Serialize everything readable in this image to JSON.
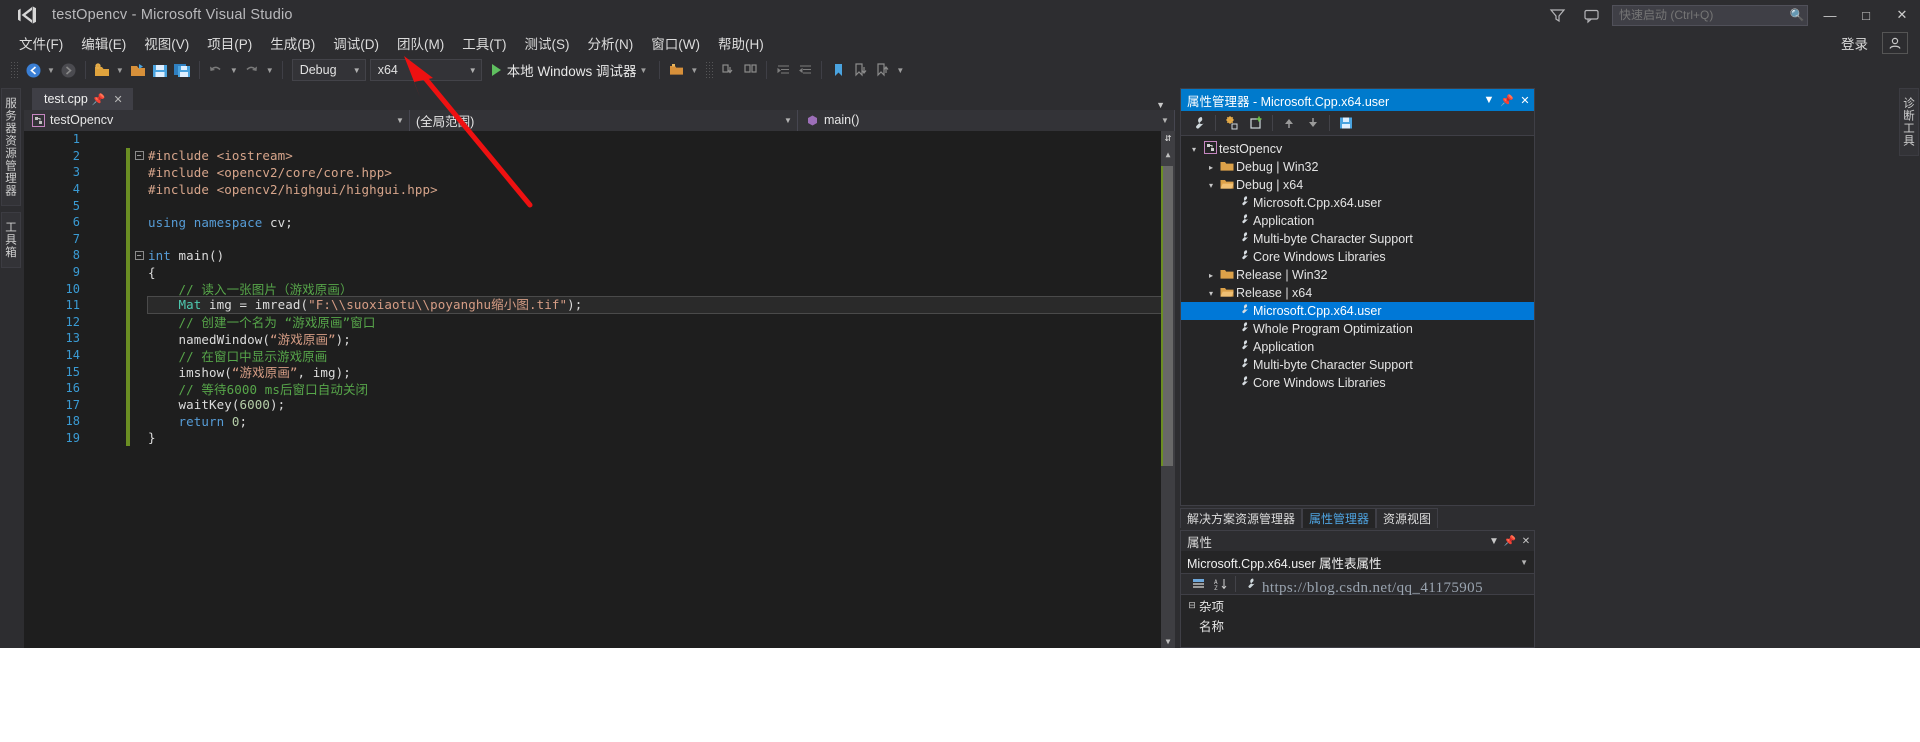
{
  "app": {
    "title": "testOpencv - Microsoft Visual Studio",
    "logo_icon": "visual-studio-logo"
  },
  "titlebar": {
    "filter_icon": "funnel-icon",
    "feedback_icon": "feedback-icon",
    "quick_launch_placeholder": "快速启动 (Ctrl+Q)",
    "quick_launch_value": "",
    "search_icon": "search-icon",
    "minimize": "—",
    "maximize": "□",
    "close": "✕"
  },
  "menubar": {
    "items": [
      {
        "label": "文件(F)"
      },
      {
        "label": "编辑(E)"
      },
      {
        "label": "视图(V)"
      },
      {
        "label": "项目(P)"
      },
      {
        "label": "生成(B)"
      },
      {
        "label": "调试(D)"
      },
      {
        "label": "团队(M)"
      },
      {
        "label": "工具(T)"
      },
      {
        "label": "测试(S)"
      },
      {
        "label": "分析(N)"
      },
      {
        "label": "窗口(W)"
      },
      {
        "label": "帮助(H)"
      }
    ],
    "login_label": "登录",
    "account_icon": "account-icon"
  },
  "toolbar": {
    "nav_back_icon": "navigate-back-icon",
    "nav_forward_icon": "navigate-forward-icon",
    "new_project_icon": "new-project-icon",
    "open_file_icon": "open-file-icon",
    "save_icon": "save-icon",
    "save_all_icon": "save-all-icon",
    "undo_icon": "undo-icon",
    "redo_icon": "redo-icon",
    "config_value": "Debug",
    "platform_value": "x64",
    "run_icon": "start-debug-icon",
    "run_label": "本地 Windows 调试器",
    "extra_icons": [
      "folder-icon",
      "step-into-icon",
      "step-over-icon",
      "indent-icon",
      "outdent-icon",
      "bookmark-icon",
      "bookmark-next-icon",
      "bookmark-prev-icon"
    ]
  },
  "left_rail": {
    "tabs": [
      {
        "label": "服务器资源管理器"
      },
      {
        "label": "工具箱"
      }
    ]
  },
  "right_rail": {
    "tabs": [
      {
        "label": "诊断工具"
      }
    ]
  },
  "editor": {
    "tab": {
      "filename": "test.cpp",
      "pin_icon": "pin-icon",
      "close_icon": "close-icon"
    },
    "tabstrip_overflow_icon": "chevron-down-icon",
    "navbar": {
      "project": "testOpencv",
      "project_icon": "cpp-project-icon",
      "scope": "(全局范围)",
      "function": "main()",
      "function_icon": "method-icon",
      "dropdown_icon": "chevron-down-icon"
    },
    "lines": [
      {
        "n": "1",
        "change": "none",
        "fold": "none",
        "tokens": []
      },
      {
        "n": "2",
        "change": "green",
        "fold": "minus",
        "tokens": [
          {
            "t": "pre",
            "v": "#include <iostream>"
          }
        ]
      },
      {
        "n": "3",
        "change": "green",
        "fold": "bar",
        "tokens": [
          {
            "t": "pre",
            "v": "#include <opencv2/core/core.hpp>"
          }
        ]
      },
      {
        "n": "4",
        "change": "green",
        "fold": "barend",
        "tokens": [
          {
            "t": "pre",
            "v": "#include <opencv2/highgui/highgui.hpp>"
          }
        ]
      },
      {
        "n": "5",
        "change": "green",
        "fold": "none",
        "tokens": []
      },
      {
        "n": "6",
        "change": "green",
        "fold": "none",
        "tokens": [
          {
            "t": "kw",
            "v": "using namespace "
          },
          {
            "t": "plain",
            "v": "cv;"
          }
        ]
      },
      {
        "n": "7",
        "change": "green",
        "fold": "none",
        "tokens": []
      },
      {
        "n": "8",
        "change": "green",
        "fold": "minus",
        "tokens": [
          {
            "t": "kw",
            "v": "int "
          },
          {
            "t": "plain",
            "v": "main()"
          }
        ]
      },
      {
        "n": "9",
        "change": "green",
        "fold": "bar",
        "tokens": [
          {
            "t": "plain",
            "v": "{"
          }
        ]
      },
      {
        "n": "10",
        "change": "green",
        "fold": "dash",
        "tokens": [
          {
            "t": "cmt",
            "v": "    // 读入一张图片（游戏原画）"
          }
        ]
      },
      {
        "n": "11",
        "change": "green",
        "fold": "dash",
        "highlight": true,
        "tokens": [
          {
            "t": "type",
            "v": "    Mat "
          },
          {
            "t": "plain",
            "v": "img = imread("
          },
          {
            "t": "str",
            "v": "\"F:\\\\suoxiaotu\\\\poyanghu缩小图.tif\""
          },
          {
            "t": "plain",
            "v": ");"
          }
        ]
      },
      {
        "n": "12",
        "change": "green",
        "fold": "dash",
        "tokens": [
          {
            "t": "cmt",
            "v": "    // 创建一个名为 “游戏原画”窗口"
          }
        ]
      },
      {
        "n": "13",
        "change": "green",
        "fold": "dash",
        "tokens": [
          {
            "t": "plain",
            "v": "    namedWindow("
          },
          {
            "t": "str",
            "v": "“游戏原画”"
          },
          {
            "t": "plain",
            "v": ");"
          }
        ]
      },
      {
        "n": "14",
        "change": "green",
        "fold": "dash",
        "tokens": [
          {
            "t": "cmt",
            "v": "    // 在窗口中显示游戏原画"
          }
        ]
      },
      {
        "n": "15",
        "change": "green",
        "fold": "dash",
        "tokens": [
          {
            "t": "plain",
            "v": "    imshow("
          },
          {
            "t": "str",
            "v": "“游戏原画”"
          },
          {
            "t": "plain",
            "v": ", img);"
          }
        ]
      },
      {
        "n": "16",
        "change": "green",
        "fold": "dash",
        "tokens": [
          {
            "t": "cmt",
            "v": "    // 等待6000 ms后窗口自动关闭"
          }
        ]
      },
      {
        "n": "17",
        "change": "green",
        "fold": "dash",
        "tokens": [
          {
            "t": "plain",
            "v": "    waitKey("
          },
          {
            "t": "num",
            "v": "6000"
          },
          {
            "t": "plain",
            "v": ");"
          }
        ]
      },
      {
        "n": "18",
        "change": "green",
        "fold": "dash",
        "tokens": [
          {
            "t": "kw",
            "v": "    return "
          },
          {
            "t": "num",
            "v": "0"
          },
          {
            "t": "plain",
            "v": ";"
          }
        ]
      },
      {
        "n": "19",
        "change": "green",
        "fold": "barend",
        "tokens": [
          {
            "t": "plain",
            "v": "}"
          }
        ]
      }
    ],
    "scroll": {
      "up_arrow_icon": "scroll-up-icon",
      "down_arrow_icon": "scroll-down-icon",
      "split_icon": "split-view-icon"
    }
  },
  "property_manager": {
    "title": "属性管理器 - Microsoft.Cpp.x64.user",
    "dropdown_icon": "chevron-down-icon",
    "pin_icon": "pin-icon",
    "close_icon": "close-icon",
    "toolbar_icons": [
      "wrench-icon",
      "add-property-sheet-icon",
      "add-new-project-property-sheet-icon",
      "move-up-icon",
      "move-down-icon",
      "save-icon"
    ],
    "tree": [
      {
        "indent": 0,
        "arrow": "down",
        "icon": "cpp-project-icon",
        "label": "testOpencv",
        "selected": false
      },
      {
        "indent": 1,
        "arrow": "right",
        "icon": "folder-icon",
        "label": "Debug | Win32",
        "selected": false
      },
      {
        "indent": 1,
        "arrow": "down",
        "icon": "folder-open-icon",
        "label": "Debug | x64",
        "selected": false
      },
      {
        "indent": 2,
        "arrow": "none",
        "icon": "property-sheet-icon",
        "label": "Microsoft.Cpp.x64.user",
        "selected": false
      },
      {
        "indent": 2,
        "arrow": "none",
        "icon": "property-sheet-icon",
        "label": "Application",
        "selected": false
      },
      {
        "indent": 2,
        "arrow": "none",
        "icon": "property-sheet-icon",
        "label": "Multi-byte Character Support",
        "selected": false
      },
      {
        "indent": 2,
        "arrow": "none",
        "icon": "property-sheet-icon",
        "label": "Core Windows Libraries",
        "selected": false
      },
      {
        "indent": 1,
        "arrow": "right",
        "icon": "folder-icon",
        "label": "Release | Win32",
        "selected": false
      },
      {
        "indent": 1,
        "arrow": "down",
        "icon": "folder-open-icon",
        "label": "Release | x64",
        "selected": false
      },
      {
        "indent": 2,
        "arrow": "none",
        "icon": "property-sheet-icon",
        "label": "Microsoft.Cpp.x64.user",
        "selected": true
      },
      {
        "indent": 2,
        "arrow": "none",
        "icon": "property-sheet-icon",
        "label": "Whole Program Optimization",
        "selected": false
      },
      {
        "indent": 2,
        "arrow": "none",
        "icon": "property-sheet-icon",
        "label": "Application",
        "selected": false
      },
      {
        "indent": 2,
        "arrow": "none",
        "icon": "property-sheet-icon",
        "label": "Multi-byte Character Support",
        "selected": false
      },
      {
        "indent": 2,
        "arrow": "none",
        "icon": "property-sheet-icon",
        "label": "Core Windows Libraries",
        "selected": false
      }
    ],
    "tabs": [
      {
        "label": "解决方案资源管理器",
        "active": false
      },
      {
        "label": "属性管理器",
        "active": true
      },
      {
        "label": "资源视图",
        "active": false
      }
    ]
  },
  "properties": {
    "title": "属性",
    "dropdown_icon": "chevron-down-icon",
    "pin_icon": "pin-icon",
    "close_icon": "close-icon",
    "object_name": "Microsoft.Cpp.x64.user 属性表属性",
    "object_dropdown_icon": "chevron-down-icon",
    "toolbar_icons": [
      "categorized-icon",
      "alphabetical-icon",
      "property-pages-icon"
    ],
    "rows": [
      {
        "expander": "minus",
        "label": "杂项"
      },
      {
        "expander": "none",
        "label": "名称"
      }
    ]
  },
  "watermark": {
    "url": "https://blog.csdn.net/qq_41175905",
    "sub": ""
  },
  "annotation": {
    "arrow_name": "red-pointer-arrow",
    "color": "#ee1111",
    "points_to": "platform-combo-x64"
  },
  "colors": {
    "accent": "#007acc",
    "selection": "#0078d7",
    "chrome": "#2d2d30",
    "editor_bg": "#1e1e1e",
    "panel_bg": "#252526",
    "comment": "#57a64a",
    "string": "#d69d85",
    "keyword": "#569cd6",
    "type": "#4ec9b0",
    "preproc": "#d7a58b",
    "linenum": "#3a9bd4",
    "changebar_green": "#6b8e23"
  }
}
